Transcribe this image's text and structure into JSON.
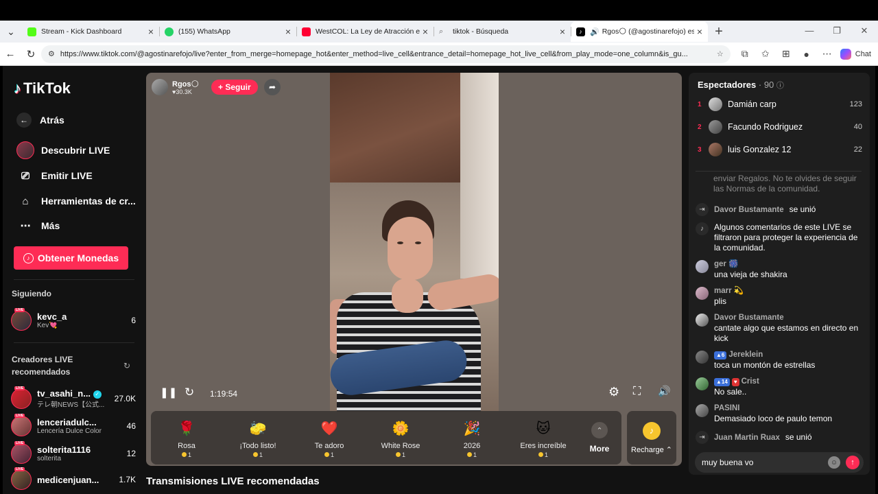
{
  "browser": {
    "tabs": [
      {
        "title": "Stream - Kick Dashboard",
        "color": "#53fc18"
      },
      {
        "title": "(155) WhatsApp",
        "color": "#25d366"
      },
      {
        "title": "WestCOL: La Ley de Atracción en P",
        "color": "#ff0033"
      },
      {
        "title": "tiktok - Búsqueda",
        "color": "#eef0f4"
      },
      {
        "title": "Rgos🌕 (@agostinarefojo) es",
        "color": "#000000"
      }
    ],
    "url": "https://www.tiktok.com/@agostinarefojo/live?enter_from_merge=homepage_hot&enter_method=live_cell&entrance_detail=homepage_hot_live_cell&from_play_mode=one_column&is_gu...",
    "chat_label": "Chat"
  },
  "sidebar": {
    "logo": "TikTok",
    "back": "Atrás",
    "nav": [
      "Descubrir LIVE",
      "Emitir LIVE",
      "Herramientas de cr...",
      "Más"
    ],
    "coins_button": "Obtener Monedas",
    "following_title": "Siguiendo",
    "following": [
      {
        "name": "kevc_a",
        "sub": "Kev💘",
        "count": "6"
      }
    ],
    "creators_title": "Creadores LIVE recomendados",
    "creators": [
      {
        "name": "tv_asahi_n...",
        "sub": "テレ朝NEWS【公式...",
        "count": "27.0K"
      },
      {
        "name": "lenceriadulc...",
        "sub": "Lencería Dulce Color",
        "count": "46"
      },
      {
        "name": "solterita1116",
        "sub": "solterita",
        "count": "12"
      },
      {
        "name": "medicenjuan...",
        "sub": "",
        "count": "1.7K"
      }
    ]
  },
  "stream": {
    "host_name": "Rgos🌕",
    "host_likes": "♥30.3K",
    "follow_label": "+ Seguir",
    "time": "1:19:54",
    "gifts": [
      {
        "name": "Rosa",
        "price": "1",
        "icon": "🌹"
      },
      {
        "name": "¡Todo listo!",
        "price": "1",
        "icon": "🧽"
      },
      {
        "name": "Te adoro",
        "price": "1",
        "icon": "❤️"
      },
      {
        "name": "White Rose",
        "price": "1",
        "icon": "🌼"
      },
      {
        "name": "2026",
        "price": "1",
        "icon": "🎉"
      },
      {
        "name": "Eres increíble",
        "price": "1",
        "icon": "🐱"
      }
    ],
    "more_label": "More",
    "recharge_label": "Recharge ⌃",
    "recommended_title": "Transmisiones LIVE recomendadas"
  },
  "chat": {
    "viewers_label": "Espectadores",
    "viewers_count": "· 90",
    "top": [
      {
        "rank": "1",
        "name": "Damián carp",
        "score": "123"
      },
      {
        "rank": "2",
        "name": "Facundo Rodriguez",
        "score": "40"
      },
      {
        "rank": "3",
        "name": "luis Gonzalez 12",
        "score": "22"
      }
    ],
    "faded": "enviar Regalos. No te olvides de seguir las Normas de la comunidad.",
    "messages": [
      {
        "who": "Davor Bustamante",
        "text": "se unió",
        "type": "join"
      },
      {
        "who": "",
        "text": "Algunos comentarios de este LIVE se filtraron para proteger la experiencia de la comunidad.",
        "type": "system"
      },
      {
        "who": "ger 🎆",
        "text": "una vieja de shakira",
        "type": "msg"
      },
      {
        "who": "marr 💫",
        "text": "plis",
        "type": "msg"
      },
      {
        "who": "Davor Bustamante",
        "text": "cantate algo que estamos en directo en kick",
        "type": "msg"
      },
      {
        "who": "Jereklein",
        "badge": "6",
        "text": "toca un montón de estrellas",
        "type": "msg"
      },
      {
        "who": "Crist",
        "badge": "14",
        "text": "No sale..",
        "type": "msg"
      },
      {
        "who": "PASINI",
        "text": "Demasiado loco de paulo temon",
        "type": "msg"
      },
      {
        "who": "Juan Martin Ruax",
        "text": "se unió",
        "type": "join"
      }
    ],
    "input_value": "muy buena vo"
  }
}
